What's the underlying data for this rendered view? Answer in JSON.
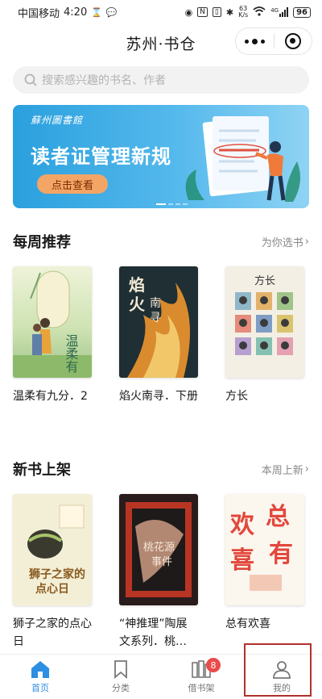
{
  "status_bar": {
    "carrier": "中国移动",
    "time": "4:20",
    "net_speed_value": "63",
    "net_speed_unit": "K/s",
    "signal": "4G",
    "battery": "96"
  },
  "header": {
    "title": "苏州·书仓"
  },
  "search": {
    "placeholder": "搜索感兴趣的书名、作者"
  },
  "banner": {
    "library_name": "蘇州圖書館",
    "headline": "读者证管理新规",
    "cta": "点击查看",
    "colors": {
      "bg": "#2aa0de",
      "cta": "#f3a566"
    }
  },
  "weekly": {
    "title": "每周推荐",
    "more": "为你选书",
    "books": [
      {
        "title": "温柔有九分．2",
        "cover_text": "温柔有九分"
      },
      {
        "title": "焰火南寻．下册",
        "cover_text": "焰火南寻"
      },
      {
        "title": "方长",
        "cover_text": "方长"
      }
    ]
  },
  "newbooks": {
    "title": "新书上架",
    "more": "本周上新",
    "books": [
      {
        "title": "狮子之家的点心日",
        "cover_text": "狮子之家的点心日"
      },
      {
        "title": "“神推理”陶展文系列．桃…",
        "cover_text": "桃花源事件"
      },
      {
        "title": "总有欢喜",
        "cover_text": "总有欢喜"
      }
    ]
  },
  "tabbar": {
    "items": [
      {
        "label": "首页",
        "icon": "home-icon",
        "active": true
      },
      {
        "label": "分类",
        "icon": "bookmark-icon",
        "active": false
      },
      {
        "label": "借书架",
        "icon": "bookshelf-icon",
        "active": false,
        "badge": "8"
      },
      {
        "label": "我的",
        "icon": "user-icon",
        "active": false
      }
    ],
    "active_color": "#2d8ee2"
  }
}
